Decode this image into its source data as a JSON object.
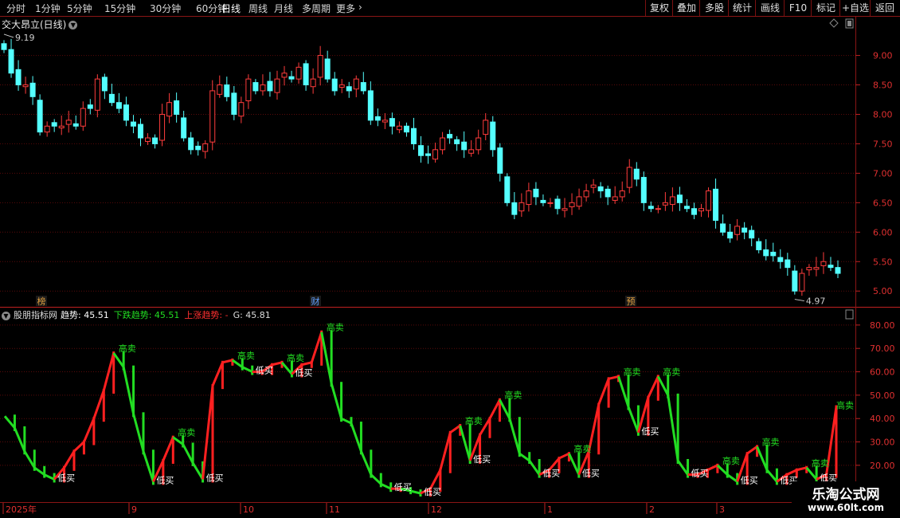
{
  "toolbar": {
    "periods": [
      "分时",
      "1分钟",
      "5分钟",
      "15分钟",
      "30分钟",
      "60分钟",
      "日线",
      "周线",
      "月线",
      "多周期",
      "更多"
    ],
    "active": "日线",
    "more_arrow": "›",
    "right_buttons": [
      "复权",
      "叠加",
      "多股",
      "统计",
      "画线",
      "F10",
      "标记",
      "+自选",
      "返回"
    ]
  },
  "main_chart": {
    "title": "交大昂立(日线)",
    "high_label": "9.19",
    "low_label": "4.97",
    "price_ticks": [
      "9.00",
      "8.50",
      "8.00",
      "7.50",
      "7.00",
      "6.50",
      "6.00",
      "5.50",
      "5.00"
    ],
    "markers": [
      "榜",
      "财",
      "预"
    ],
    "up_color": "#ff3c3c",
    "down_color": "#54ffff"
  },
  "indicator": {
    "name": "股朋指标网",
    "trend_label": "趋势: 45.51",
    "down_label": "下跌趋势: 45.51",
    "up_label": "上涨趋势: -",
    "g_label": "G: 45.81",
    "ticks": [
      "80.00",
      "70.00",
      "60.00",
      "50.00",
      "40.00",
      "30.00",
      "20.00"
    ],
    "sell_label": "高卖",
    "buy_label": "低买",
    "up_color": "#ff2020",
    "down_color": "#22dd22"
  },
  "date_axis": [
    "2025年",
    "9",
    "10",
    "11",
    "12",
    "1",
    "2",
    "3"
  ],
  "watermark": {
    "line1": "乐淘公式网",
    "line2": "www.60lt.com"
  },
  "chart_data": [
    {
      "type": "candlestick",
      "title": "交大昂立(日线)",
      "ylim": [
        4.8,
        9.4
      ],
      "close": [
        9.1,
        8.7,
        8.5,
        8.5,
        8.3,
        7.7,
        7.8,
        7.8,
        7.8,
        7.9,
        7.8,
        8.1,
        8.1,
        8.6,
        8.4,
        8.2,
        8.1,
        7.9,
        7.8,
        7.6,
        7.6,
        7.5,
        8.0,
        8.2,
        8.0,
        7.6,
        7.4,
        7.4,
        7.5,
        8.4,
        8.5,
        8.3,
        8.0,
        8.2,
        8.6,
        8.4,
        8.5,
        8.4,
        8.6,
        8.7,
        8.6,
        8.8,
        8.5,
        8.6,
        9.0,
        8.6,
        8.4,
        8.5,
        8.4,
        8.6,
        8.4,
        7.9,
        7.9,
        7.9,
        7.8,
        7.8,
        7.7,
        7.5,
        7.3,
        7.3,
        7.4,
        7.6,
        7.6,
        7.5,
        7.4,
        7.4,
        7.6,
        7.9,
        7.4,
        7.0,
        6.5,
        6.3,
        6.5,
        6.7,
        6.6,
        6.5,
        6.5,
        6.4,
        6.4,
        6.5,
        6.6,
        6.7,
        6.8,
        6.7,
        6.6,
        6.6,
        6.7,
        7.1,
        6.9,
        6.5,
        6.4,
        6.4,
        6.5,
        6.6,
        6.5,
        6.4,
        6.3,
        6.4,
        6.7,
        6.2,
        6.0,
        5.9,
        6.1,
        6.0,
        5.9,
        5.7,
        5.6,
        5.6,
        5.5,
        5.4,
        5.0,
        5.3,
        5.4,
        5.4,
        5.5,
        5.4,
        5.3
      ]
    },
    {
      "type": "line",
      "title": "股朋指标网",
      "ylim": [
        7,
        82
      ],
      "series": [
        {
          "name": "趋势",
          "values": [
            41,
            36,
            26,
            19,
            16,
            14,
            19,
            26,
            30,
            40,
            52,
            68,
            62,
            42,
            26,
            13,
            22,
            32,
            29,
            21,
            14,
            54,
            64,
            65,
            62,
            60,
            60,
            63,
            64,
            59,
            63,
            64,
            77,
            55,
            40,
            38,
            26,
            16,
            12,
            10,
            10,
            9,
            8,
            10,
            18,
            34,
            37,
            22,
            33,
            40,
            48,
            40,
            25,
            22,
            16,
            18,
            23,
            25,
            16,
            26,
            46,
            57,
            58,
            45,
            34,
            49,
            58,
            50,
            22,
            16,
            16,
            18,
            20,
            16,
            13,
            25,
            28,
            18,
            13,
            16,
            18,
            19,
            14,
            16,
            45
          ]
        }
      ],
      "annotations": [
        "高卖",
        "低买"
      ]
    }
  ]
}
